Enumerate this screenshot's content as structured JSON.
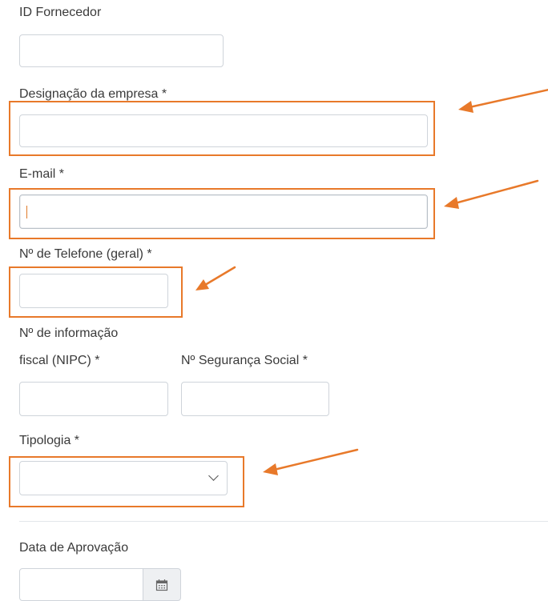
{
  "fields": {
    "id_fornecedor": {
      "label": "ID Fornecedor",
      "value": ""
    },
    "designacao": {
      "label": "Designação da empresa *",
      "value": ""
    },
    "email": {
      "label": "E-mail *",
      "value": ""
    },
    "telefone": {
      "label": "Nº de Telefone (geral) *",
      "value": ""
    },
    "nipc": {
      "label_line1": "Nº de informação",
      "label_line2": "fiscal (NIPC) *",
      "value": ""
    },
    "seguranca_social": {
      "label": "Nº Segurança Social *",
      "value": ""
    },
    "tipologia": {
      "label": "Tipologia *",
      "selected": ""
    },
    "data_aprovacao": {
      "label": "Data de Aprovação",
      "value": ""
    }
  },
  "colors": {
    "highlight": "#e8792a",
    "border": "#cfd4da",
    "label": "#3a3a3a"
  },
  "icons": {
    "calendar": "calendar-icon",
    "dropdown": "chevron-down-icon"
  }
}
